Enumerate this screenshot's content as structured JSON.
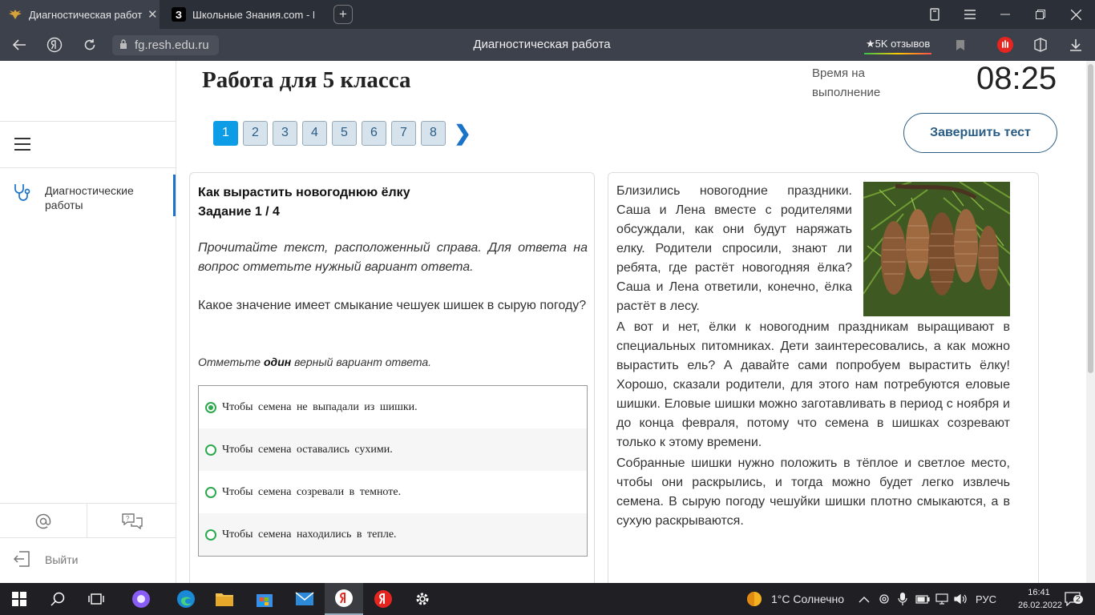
{
  "browser": {
    "tabs": [
      {
        "title": "Диагностическая работ",
        "active": true
      },
      {
        "title": "Школьные Знания.com - Г",
        "active": false
      }
    ],
    "tab2_favicon_letter": "З",
    "new_tab_symbol": "+",
    "close_symbol": "✕",
    "url": "fg.resh.edu.ru",
    "page_title": "Диагностическая работа",
    "reviews_label": "★5K отзывов"
  },
  "sidebar": {
    "items": [
      {
        "label": "Диагностические работы",
        "icon": "stethoscope-icon"
      }
    ],
    "logout_label": "Выйти"
  },
  "header": {
    "title": "Работа для 5 класса",
    "time_label": "Время на выполнение",
    "timer": "08:25",
    "finish_label": "Завершить тест"
  },
  "pagination": {
    "pages": [
      "1",
      "2",
      "3",
      "4",
      "5",
      "6",
      "7",
      "8"
    ],
    "current": "1",
    "next_symbol": "❯"
  },
  "task": {
    "title": "Как вырастить новогоднюю ёлку",
    "subtitle": "Задание 1 / 4",
    "instruction": "Прочитайте текст, расположенный справа. Для ответа на вопрос отметьте нужный вариант ответа.",
    "question": "Какое значение имеет смыкание чешуек шишек в сырую погоду?",
    "hint_before": "Отметьте ",
    "hint_bold": "один",
    "hint_after": " верный вариант ответа.",
    "options": [
      {
        "label": "Чтобы семена не выпадали из шишки.",
        "checked": true
      },
      {
        "label": "Чтобы семена оставались сухими.",
        "checked": false
      },
      {
        "label": "Чтобы семена созревали в темноте.",
        "checked": false
      },
      {
        "label": "Чтобы семена находились в тепле.",
        "checked": false
      }
    ]
  },
  "reading": {
    "paragraphs": [
      "Близились новогодние праздники. Саша и Лена вместе с родителями обсуждали, как они будут наряжать елку. Родители спросили, знают ли ребята, где растёт новогодняя ёлка? Саша и Лена ответили, конечно, ёлка растёт в лесу.",
      "А вот и нет, ёлки к новогодним праздникам выращивают в специальных питомниках. Дети заинтересовались, а как можно вырастить ель? А давайте сами попробуем вырастить ёлку! Хорошо, сказали родители, для этого нам потребуются еловые шишки. Еловые шишки можно заготавливать в период с ноября и до конца февраля, потому что семена в шишках созревают только к этому времени.",
      "Собранные шишки нужно положить в тёплое и светлое место, чтобы они раскрылись, и тогда можно будет легко извлечь семена. В сырую погоду чешуйки шишки плотно смыкаются, а в сухую раскрываются."
    ]
  },
  "taskbar": {
    "weather": "1°C Солнечно",
    "language": "РУС",
    "time": "16:41",
    "date": "26.02.2022",
    "notifications": "2"
  },
  "colors": {
    "accent": "#0d9ce6",
    "brand": "#2a5d86",
    "radio": "#2ea84e",
    "tabbar": "#2b2f37",
    "toolbar": "#3c414b"
  }
}
